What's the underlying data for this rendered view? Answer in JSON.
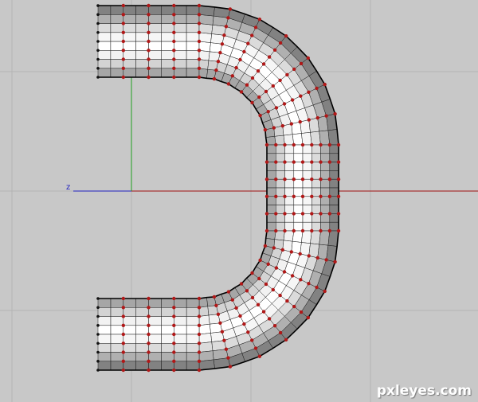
{
  "viewport": {
    "background": "#c8c8c8",
    "grid_color": "#b4b4b4",
    "axis_label": "z",
    "x_axis_color": "#a01010",
    "y_axis_color": "#20a020",
    "z_axis_color": "#2020c0",
    "mesh_line_color": "#1a1a1a",
    "control_point_color": "#b01818",
    "end_point_color": "#111111"
  },
  "watermark": "pxleyes.com"
}
